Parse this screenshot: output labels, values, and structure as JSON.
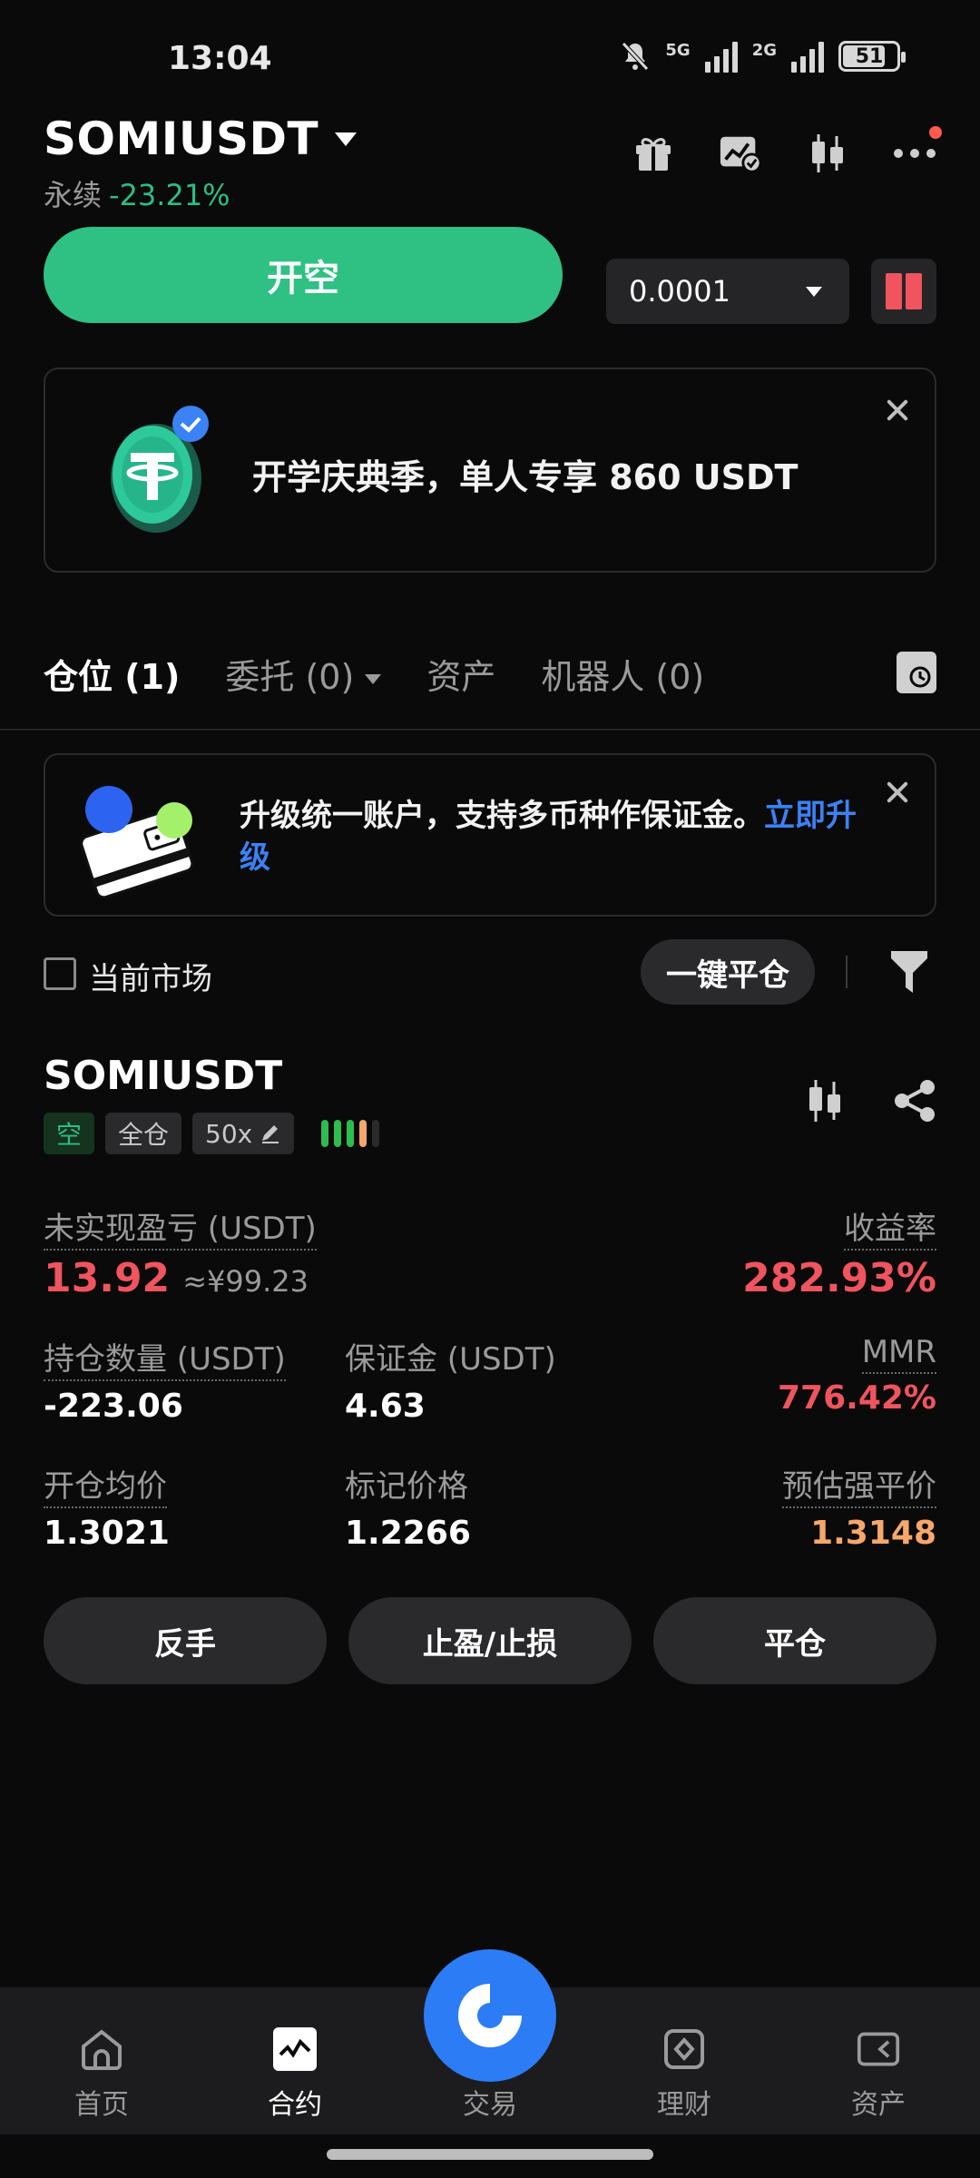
{
  "status": {
    "time": "13:04",
    "net1": "5G",
    "net2": "2G",
    "battery": "51"
  },
  "header": {
    "pair": "SOMIUSDT",
    "contract_type": "永续",
    "change_pct": "-23.21%"
  },
  "trade": {
    "open_short_label": "开空",
    "qty_value": "0.0001"
  },
  "promo": {
    "text": "开学庆典季，单人专享 860 USDT"
  },
  "tabs": [
    {
      "label": "仓位 (1)"
    },
    {
      "label": "委托 (0)"
    },
    {
      "label": "资产"
    },
    {
      "label": "机器人 (0)"
    }
  ],
  "upgrade": {
    "text": "升级统一账户，支持多币种作保证金。",
    "link": "立即升级"
  },
  "filter": {
    "current_market_label": "当前市场",
    "close_all_label": "一键平仓"
  },
  "position": {
    "symbol": "SOMIUSDT",
    "side_badge": "空",
    "margin_mode_badge": "全仓",
    "leverage_badge": "50x",
    "leverage_colors": [
      "#2dbd4e",
      "#2dbd4e",
      "#2dbd4e",
      "#f6a86a",
      "#2b2b2b"
    ],
    "unrealized_pnl_label": "未实现盈亏 (USDT)",
    "unrealized_pnl_value": "13.92",
    "unrealized_pnl_cny": "≈¥99.23",
    "roi_label": "收益率",
    "roi_value": "282.93%",
    "size_label": "持仓数量 (USDT)",
    "size_value": "-223.06",
    "margin_label": "保证金 (USDT)",
    "margin_value": "4.63",
    "mmr_label": "MMR",
    "mmr_value": "776.42%",
    "entry_label": "开仓均价",
    "entry_value": "1.3021",
    "mark_label": "标记价格",
    "mark_value": "1.2266",
    "liq_label": "预估强平价",
    "liq_value": "1.3148",
    "btn_reverse": "反手",
    "btn_tpsl": "止盈/止损",
    "btn_close": "平仓"
  },
  "nav": [
    {
      "label": "首页",
      "icon": "home-icon"
    },
    {
      "label": "合约",
      "icon": "futures-icon"
    },
    {
      "label": "交易",
      "icon": "trade-icon"
    },
    {
      "label": "理财",
      "icon": "earn-icon"
    },
    {
      "label": "资产",
      "icon": "assets-icon"
    }
  ],
  "colors": {
    "green": "#2ec183",
    "red": "#f0545f",
    "blue": "#2c7cf6",
    "orange": "#f6a86a"
  }
}
